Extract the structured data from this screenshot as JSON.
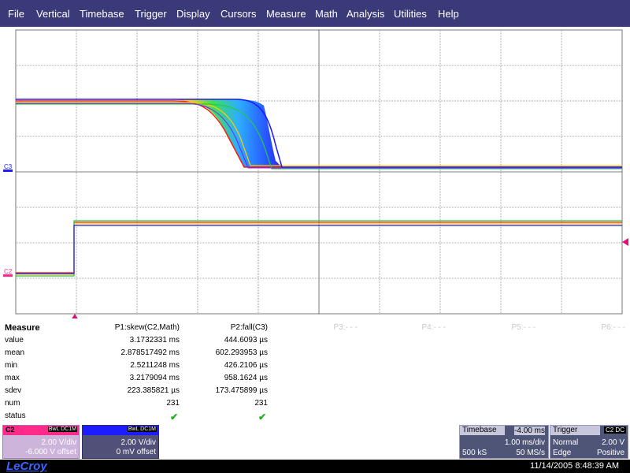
{
  "menu": [
    "File",
    "Vertical",
    "Timebase",
    "Trigger",
    "Display",
    "Cursors",
    "Measure",
    "Math",
    "Analysis",
    "Utilities",
    "Help"
  ],
  "channel_markers": {
    "c3": "C3",
    "c2": "C2"
  },
  "measure": {
    "title": "Measure",
    "columns": [
      {
        "label": "P1:skew(C2,Math)",
        "active": true
      },
      {
        "label": "P2:fall(C3)",
        "active": true
      },
      {
        "label": "P3:- - -",
        "active": false
      },
      {
        "label": "P4:- - -",
        "active": false
      },
      {
        "label": "P5:- - -",
        "active": false
      },
      {
        "label": "P6:- - -",
        "active": false
      }
    ],
    "rows": [
      {
        "label": "value",
        "p1": "3.1732331 ms",
        "p2": "444.6093 µs"
      },
      {
        "label": "mean",
        "p1": "2.878517492 ms",
        "p2": "602.293953 µs"
      },
      {
        "label": "min",
        "p1": "2.5211248 ms",
        "p2": "426.2106 µs"
      },
      {
        "label": "max",
        "p1": "3.2179094 ms",
        "p2": "958.1624 µs"
      },
      {
        "label": "sdev",
        "p1": "223.385821 µs",
        "p2": "173.475899 µs"
      },
      {
        "label": "num",
        "p1": "231",
        "p2": "231"
      },
      {
        "label": "status",
        "p1": "✔",
        "p2": "✔"
      }
    ]
  },
  "channels": {
    "c2": {
      "name": "C2",
      "tag": "BwL DC1M",
      "vdiv": "2.00 V/div",
      "offset": "-6.000 V offset",
      "color": "#ff2a8a"
    },
    "c3": {
      "name": "C3",
      "tag": "BwL DC1M",
      "vdiv": "2.00 V/div",
      "offset": "0 mV offset",
      "color": "#1c1cff"
    }
  },
  "timebase": {
    "title": "Timebase",
    "delay": "-4.00 ms",
    "tdiv": "1.00 ms/div",
    "samples": "500 kS",
    "rate": "50 MS/s"
  },
  "trigger": {
    "title": "Trigger",
    "source": "C2 DC",
    "level": "2.00 V",
    "mode": "Normal",
    "type": "Edge",
    "slope": "Positive"
  },
  "status": {
    "logo": "LeCroy",
    "datetime": "11/14/2005 8:48:39 AM"
  },
  "colors": {
    "menubar": "#3a3a78",
    "grid": "#777777",
    "trace_blue": "#1c1cff",
    "c2_pink": "#ff2a8a",
    "trigger_marker": "#e0107a"
  }
}
